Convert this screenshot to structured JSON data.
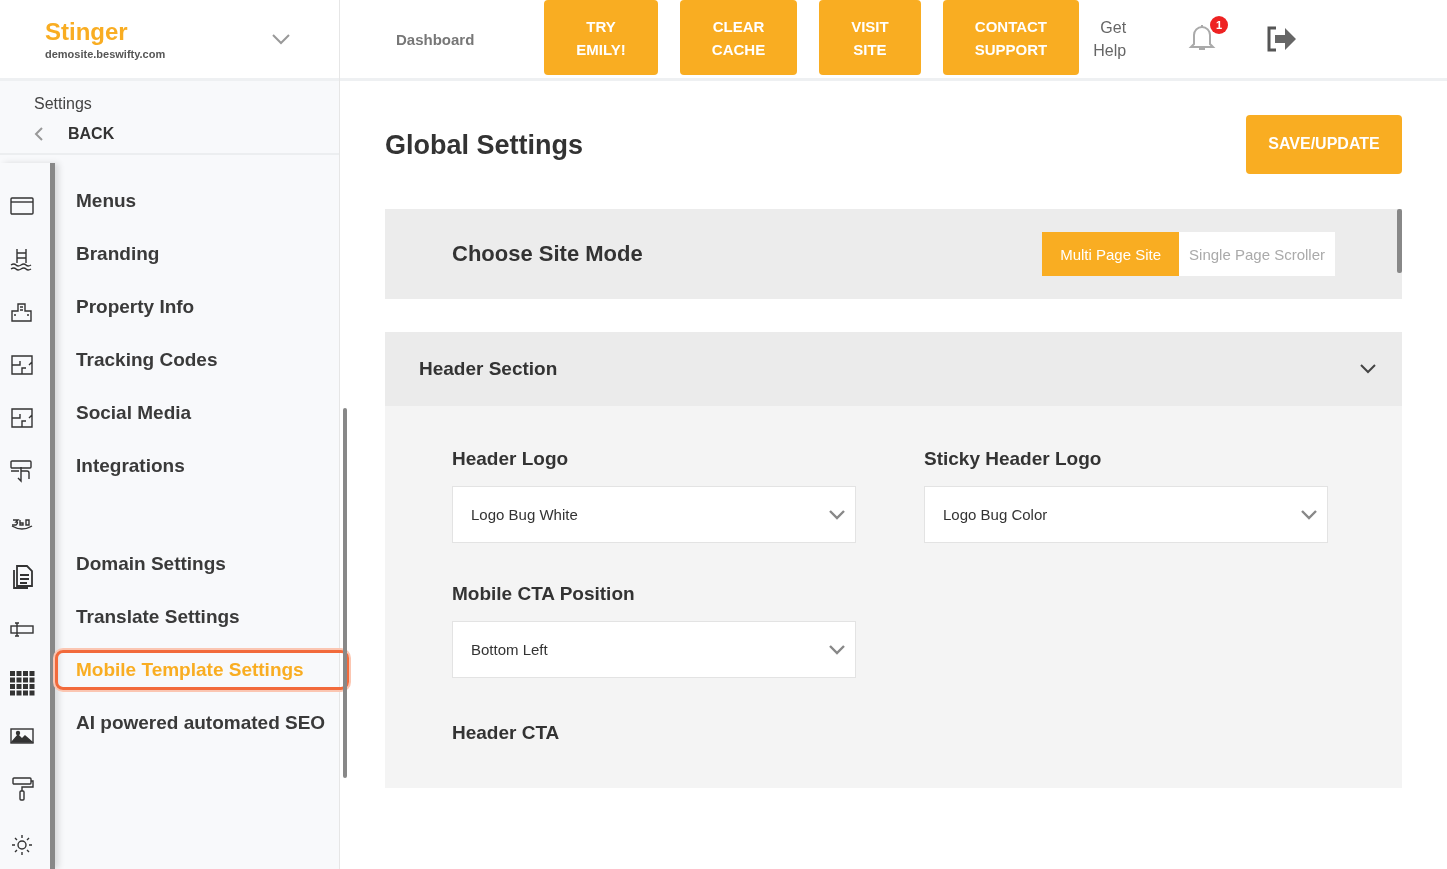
{
  "brand": {
    "name": "Stinger",
    "domain": "demosite.beswifty.com"
  },
  "topbar": {
    "dashboard": "Dashboard",
    "buttons": [
      "TRY\nEMILY!",
      "CLEAR\nCACHE",
      "VISIT\nSITE",
      "CONTACT\nSUPPORT"
    ],
    "help": "Get\nHelp",
    "notifications": "1"
  },
  "sidebar": {
    "section": "Settings",
    "back": "BACK",
    "menu_groups": [
      [
        {
          "label": "Menus",
          "selected": false
        },
        {
          "label": "Branding",
          "selected": false
        },
        {
          "label": "Property Info",
          "selected": false
        },
        {
          "label": "Tracking Codes",
          "selected": false
        },
        {
          "label": "Social Media",
          "selected": false
        },
        {
          "label": "Integrations",
          "selected": false
        }
      ],
      [
        {
          "label": "Domain Settings",
          "selected": false
        },
        {
          "label": "Translate Settings",
          "selected": false
        },
        {
          "label": "Mobile Template Settings",
          "selected": true
        },
        {
          "label": "AI powered automated SEO",
          "selected": false
        }
      ]
    ]
  },
  "page": {
    "title": "Global Settings",
    "save": "SAVE/UPDATE"
  },
  "site_mode": {
    "title": "Choose Site Mode",
    "options": [
      {
        "label": "Multi Page Site",
        "selected": true
      },
      {
        "label": "Single Page Scroller",
        "selected": false
      }
    ]
  },
  "header_section": {
    "title": "Header Section",
    "expanded": true,
    "fields": [
      {
        "label": "Header Logo",
        "value": "Logo Bug White"
      },
      {
        "label": "Sticky Header Logo",
        "value": "Logo Bug Color"
      },
      {
        "label": "Mobile CTA Position",
        "value": "Bottom Left"
      }
    ],
    "subheading": "Header CTA"
  }
}
